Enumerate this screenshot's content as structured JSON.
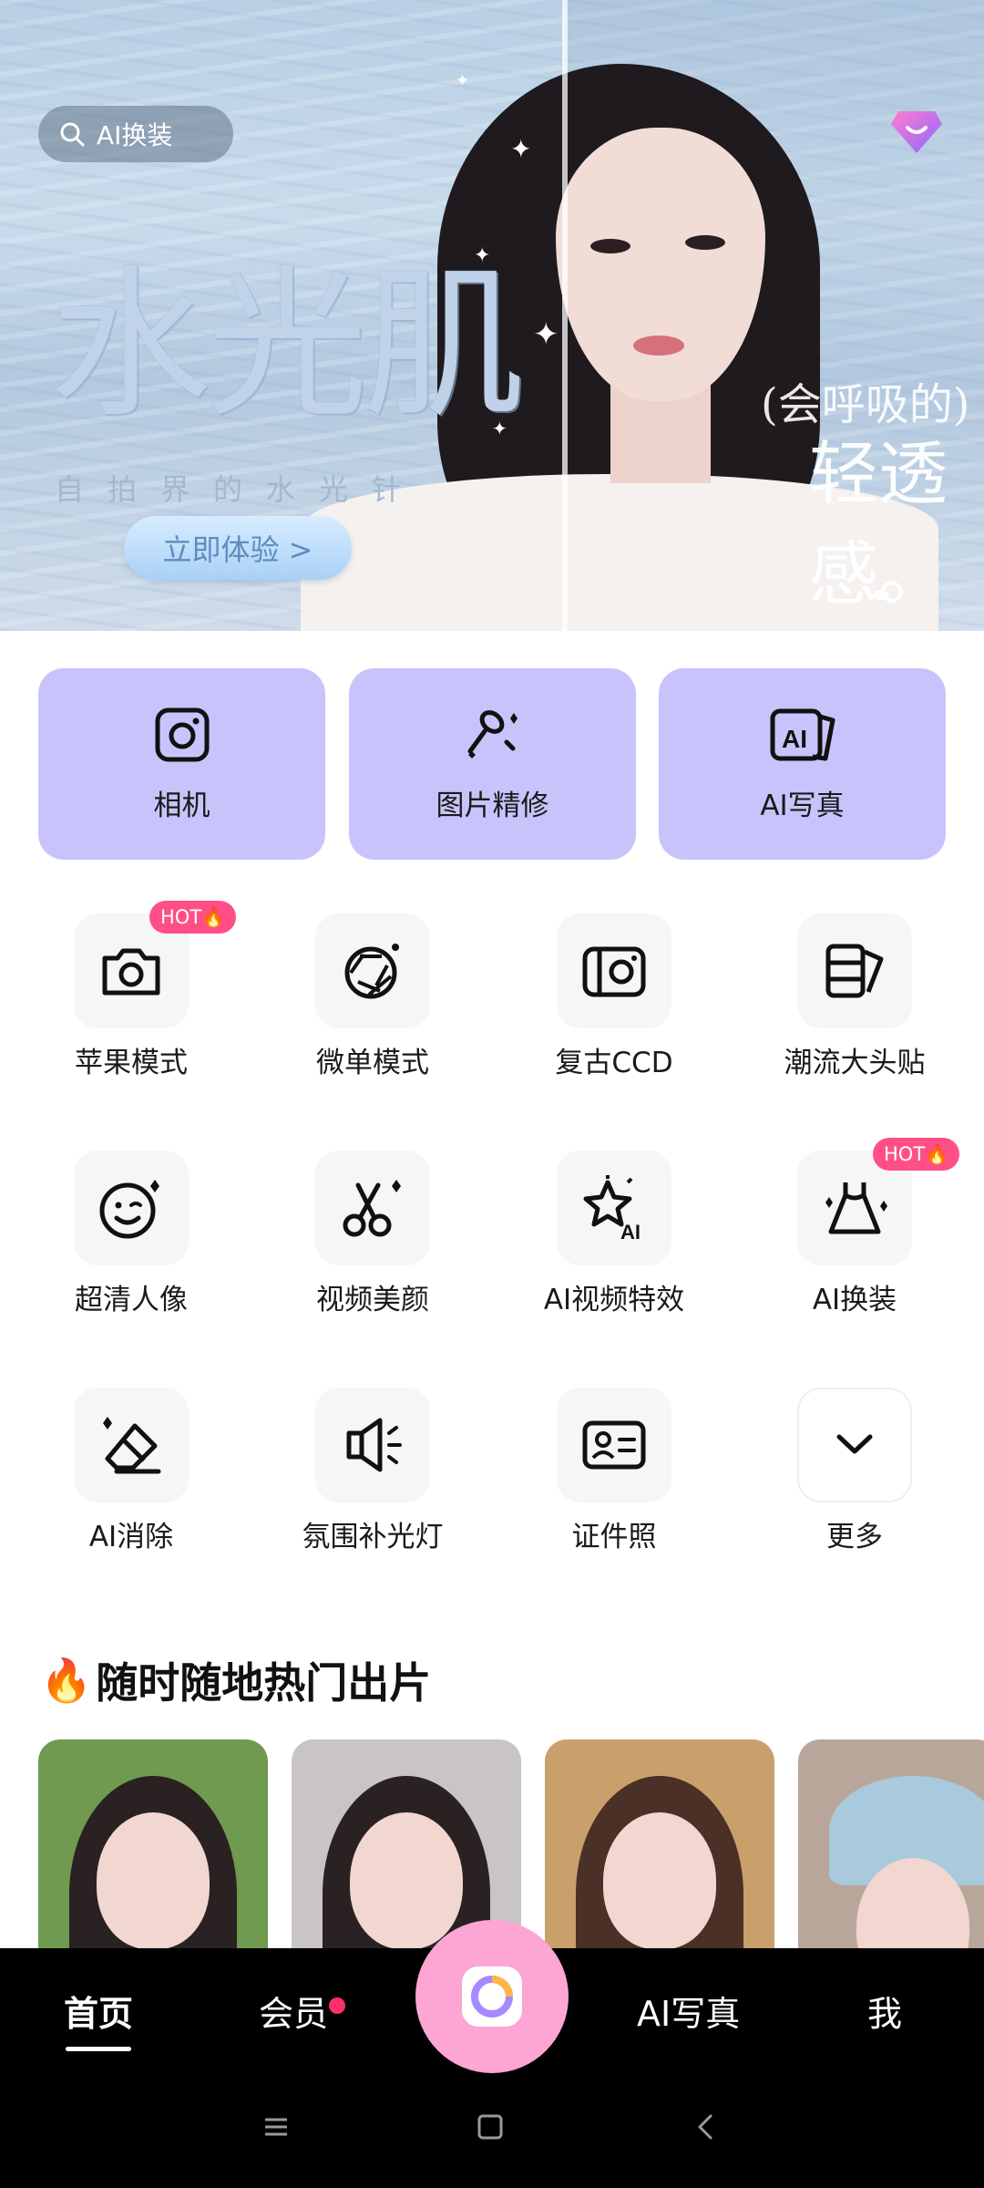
{
  "hero": {
    "search_label": "AI换装",
    "title": "水光肌",
    "subtitle": "自拍界的水光针",
    "cta_label": "立即体验 >",
    "tag_line1": "(会呼吸的)",
    "tag_line2": "轻透感。"
  },
  "big_tiles": [
    {
      "label": "相机",
      "icon": "camera-icon"
    },
    {
      "label": "图片精修",
      "icon": "makeup-brush-icon"
    },
    {
      "label": "AI写真",
      "icon": "ai-portrait-icon"
    }
  ],
  "grid": [
    {
      "label": "苹果模式",
      "icon": "camera-icon",
      "badge": "HOT🔥"
    },
    {
      "label": "微单模式",
      "icon": "aperture-icon"
    },
    {
      "label": "复古CCD",
      "icon": "retro-camera-icon"
    },
    {
      "label": "潮流大头贴",
      "icon": "photo-sticker-icon"
    },
    {
      "label": "超清人像",
      "icon": "smiley-face-icon"
    },
    {
      "label": "视频美颜",
      "icon": "scissors-icon"
    },
    {
      "label": "AI视频特效",
      "icon": "ai-effect-icon"
    },
    {
      "label": "AI换装",
      "icon": "dress-icon",
      "badge": "HOT🔥"
    },
    {
      "label": "AI消除",
      "icon": "eraser-icon"
    },
    {
      "label": "氛围补光灯",
      "icon": "fill-light-icon"
    },
    {
      "label": "证件照",
      "icon": "id-card-icon"
    },
    {
      "label": "更多",
      "icon": "chevron-down-icon"
    }
  ],
  "section": {
    "emoji": "🔥",
    "title": "随时随地热门出片"
  },
  "photos": [
    {
      "name": "photo-butterfly-girl",
      "bg": "#6f9a4f"
    },
    {
      "name": "photo-portrait-black-hair",
      "bg": "#c9c4c6"
    },
    {
      "name": "photo-hello-kitty-filter",
      "bg": "#c9a06b"
    },
    {
      "name": "photo-cap-girl",
      "bg": "#b8a69b"
    }
  ],
  "nav": {
    "home": "首页",
    "vip": "会员",
    "ai_photo": "AI写真",
    "me": "我"
  },
  "colors": {
    "tile_purple": "#c8c4fb",
    "hot_pink": "#ff4f86",
    "fab_pink": "#fda6d3",
    "nav_black": "#000000"
  }
}
